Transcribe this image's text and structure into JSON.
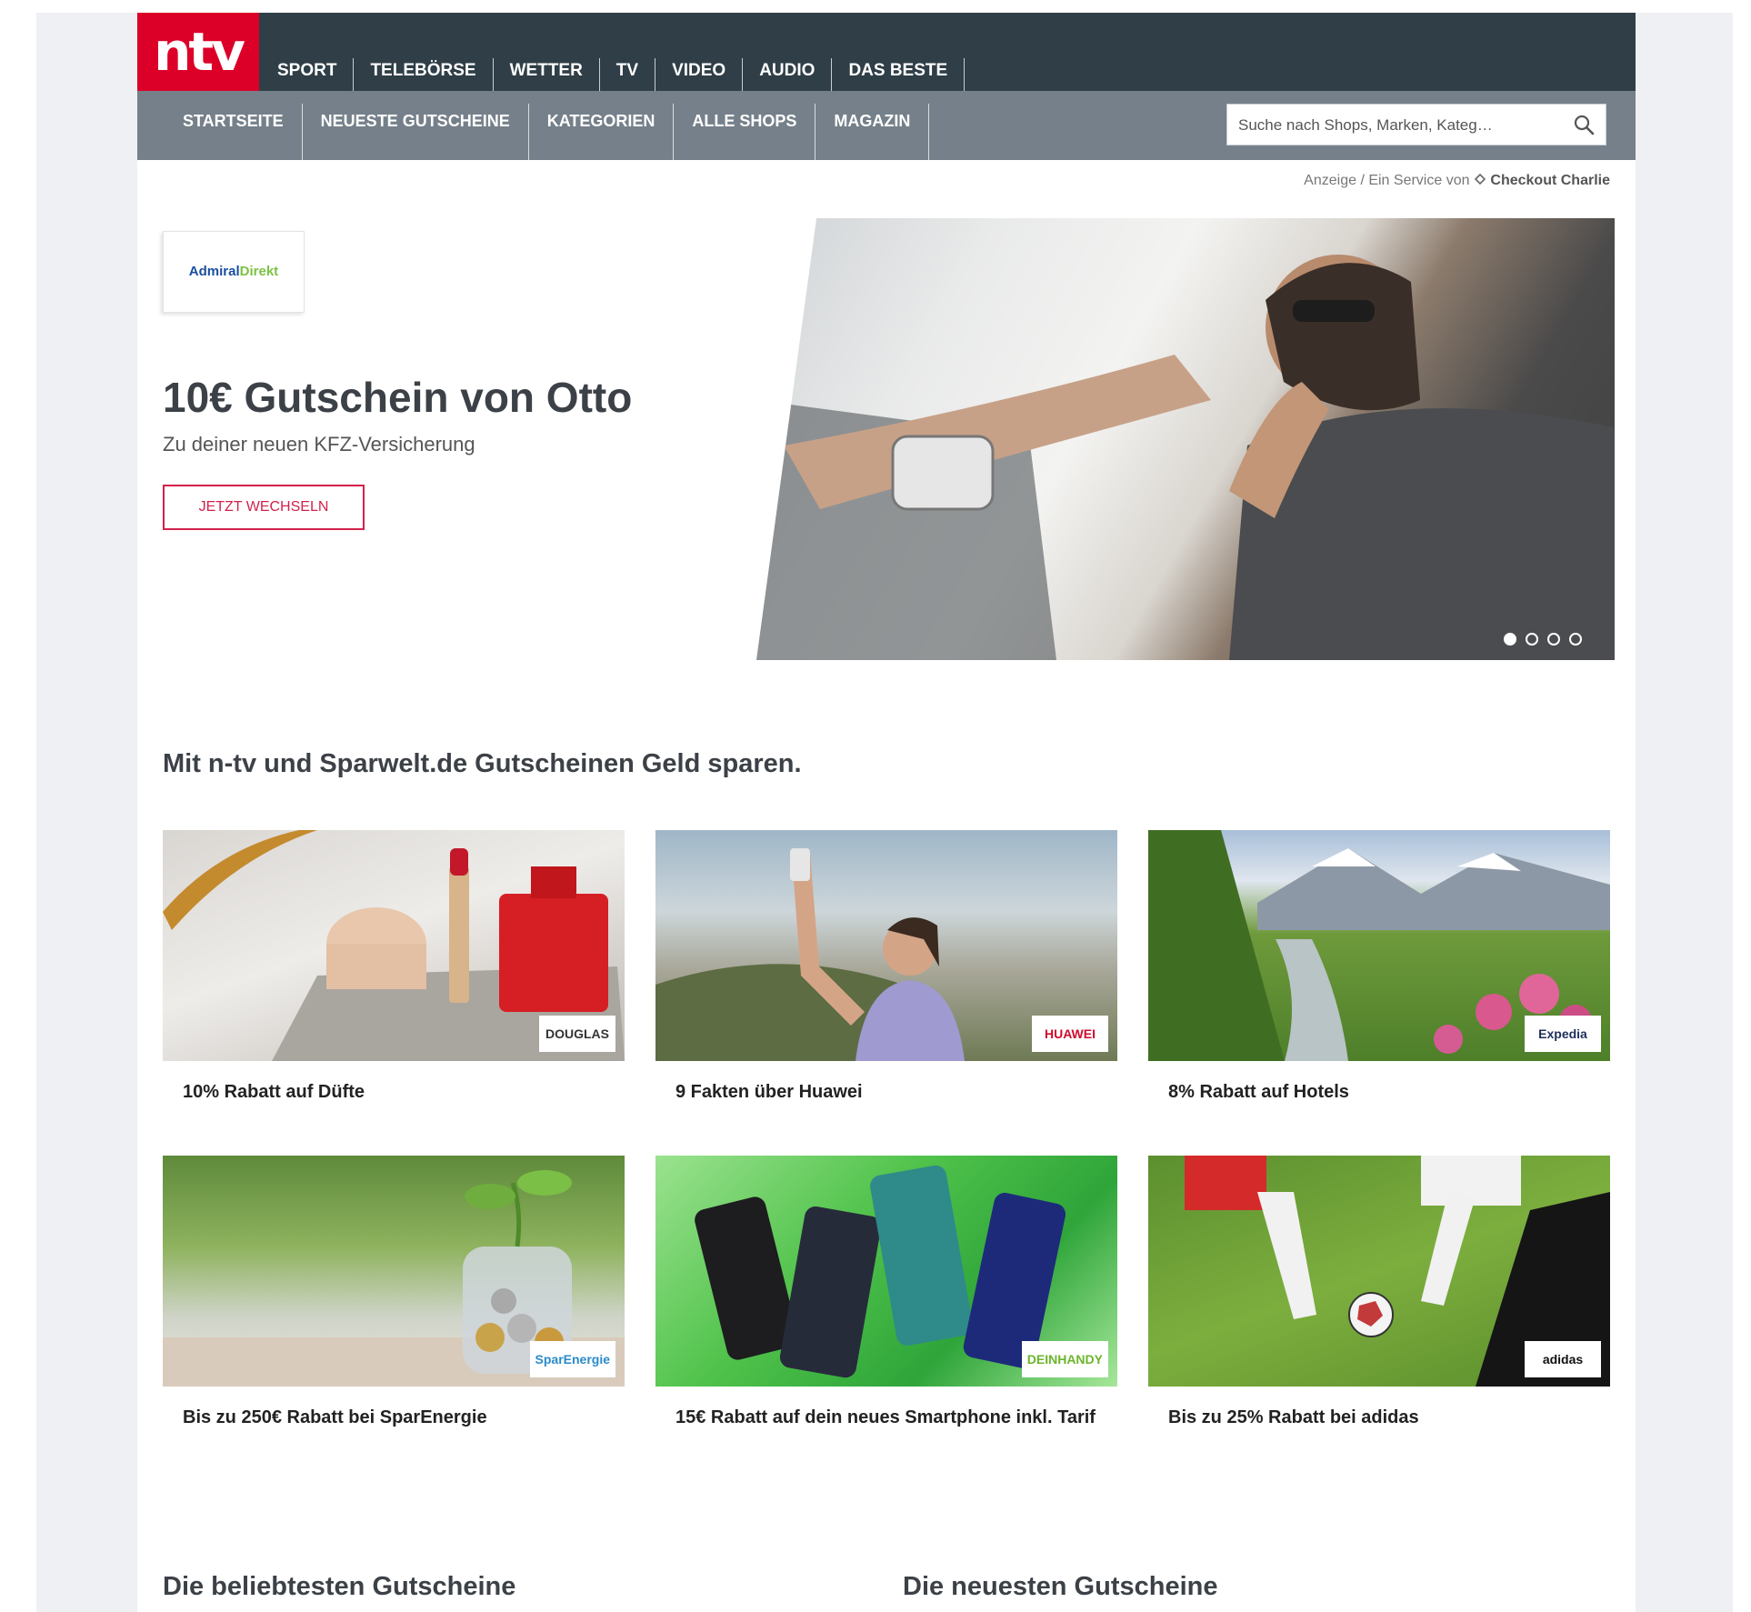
{
  "logo": "ntv",
  "main_nav": [
    "SPORT",
    "TELEBÖRSE",
    "WETTER",
    "TV",
    "VIDEO",
    "AUDIO",
    "DAS BESTE"
  ],
  "sub_nav": [
    "STARTSEITE",
    "NEUESTE GUTSCHEINE",
    "KATEGORIEN",
    "ALLE SHOPS",
    "MAGAZIN"
  ],
  "search": {
    "placeholder": "Suche nach Shops, Marken, Kateg…"
  },
  "sponsor": {
    "prefix": "Anzeige / Ein Service von",
    "brand": "Checkout Charlie"
  },
  "hero": {
    "logo_part1": "Admiral",
    "logo_part2": "Direkt",
    "title": "10€ Gutschein von Otto",
    "subtitle": "Zu deiner neuen KFZ-Versicherung",
    "button": "JETZT WECHSELN",
    "slides_total": 4,
    "slide_active": 1
  },
  "section_title": "Mit n-tv und Sparwelt.de Gutscheinen Geld sparen.",
  "cards": [
    {
      "brand": "DOUGLAS",
      "caption": "10% Rabatt auf Düfte"
    },
    {
      "brand": "HUAWEI",
      "caption": "9 Fakten über Huawei"
    },
    {
      "brand": "Expedia",
      "caption": "8% Rabatt auf Hotels"
    },
    {
      "brand": "SparEnergie",
      "caption": "Bis zu 250€ Rabatt bei SparEnergie"
    },
    {
      "brand": "DEINHANDY",
      "caption": "15€ Rabatt auf dein neues Smartphone inkl. Tarif"
    },
    {
      "brand": "adidas",
      "caption": "Bis zu 25% Rabatt bei adidas"
    }
  ],
  "bottom": {
    "left_title": "Die beliebtesten Gutscheine",
    "right_title": "Die neuesten Gutscheine"
  },
  "colors": {
    "topbar": "#2f3e47",
    "subbar": "#75808a",
    "brand_red": "#dc0028",
    "cta": "#d3224b"
  }
}
